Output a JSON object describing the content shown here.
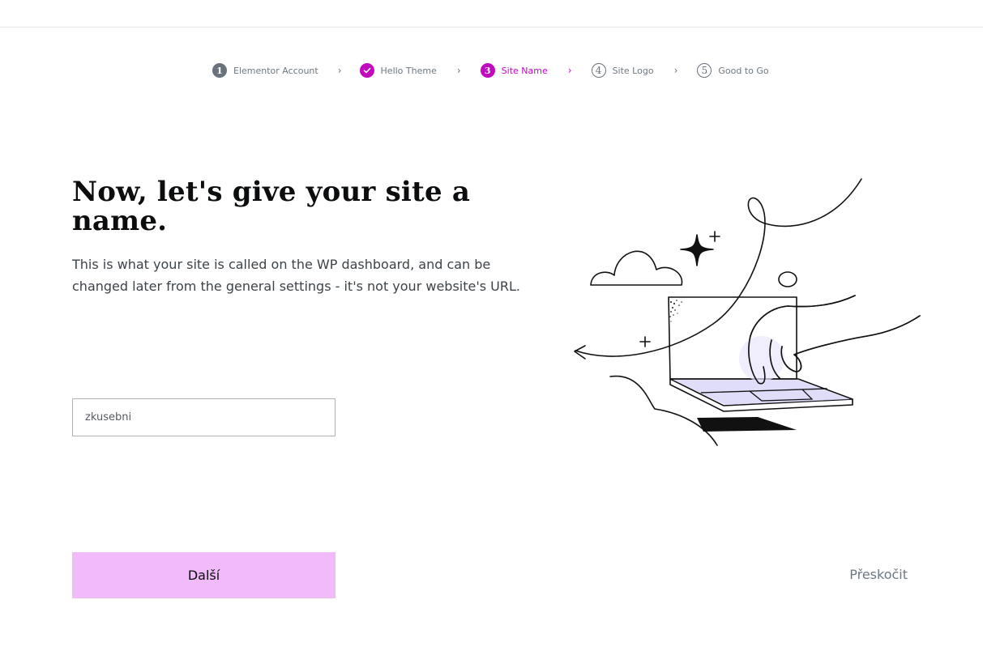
{
  "stepper": {
    "steps": [
      {
        "number": "1",
        "label": "Elementor Account",
        "state": "done-numbered"
      },
      {
        "number": "",
        "label": "Hello Theme",
        "state": "completed",
        "icon": "check-icon"
      },
      {
        "number": "3",
        "label": "Site Name",
        "state": "active"
      },
      {
        "number": "4",
        "label": "Site Logo",
        "state": "pending"
      },
      {
        "number": "5",
        "label": "Good to Go",
        "state": "pending"
      }
    ],
    "separator": "›"
  },
  "main": {
    "heading": "Now, let's give your site a name.",
    "description": "This is what your site is called on the WP dashboard, and can be changed later from the general settings - it's not your website's URL.",
    "site_name_value": "zkusebni",
    "next_label": "Další",
    "skip_label": "Přeskočit"
  },
  "colors": {
    "accent": "#c00bbf",
    "button_bg": "#f1baf9",
    "text_muted": "#69727d"
  }
}
